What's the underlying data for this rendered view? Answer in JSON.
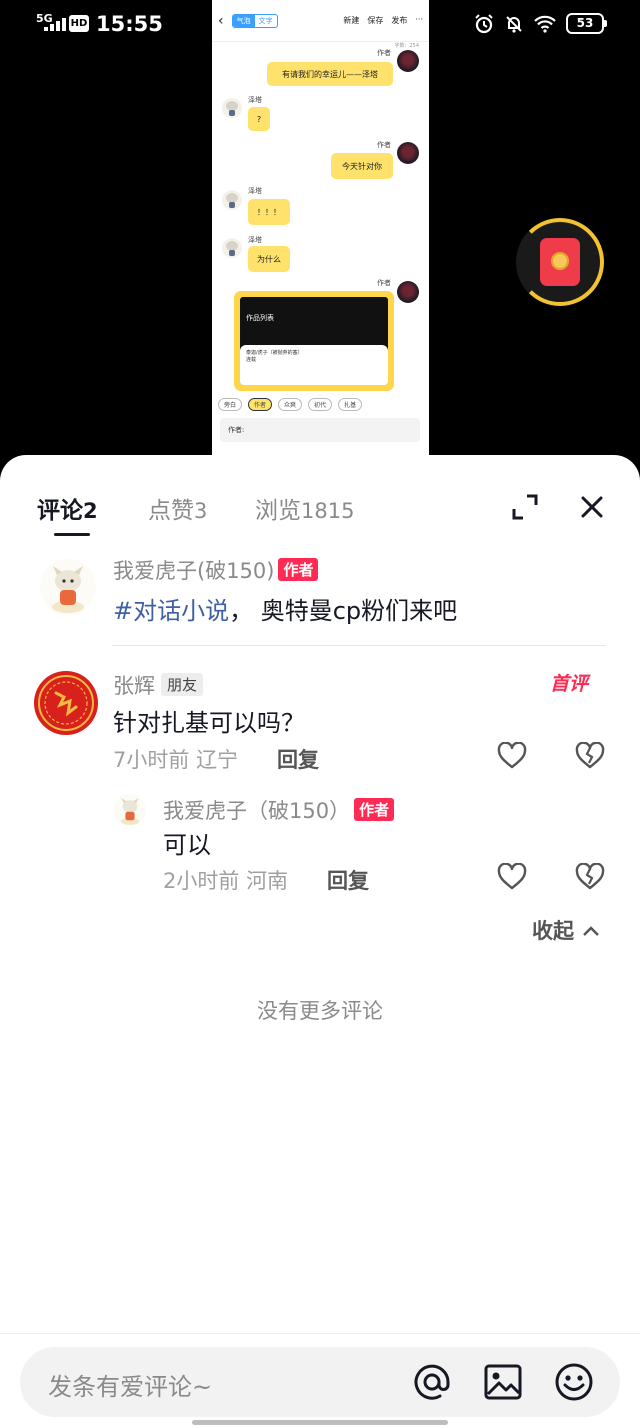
{
  "status_bar": {
    "network": "5G",
    "hd": "HD",
    "time": "15:55",
    "battery": "53"
  },
  "preview": {
    "segments": [
      "气泡",
      "文字"
    ],
    "actions": [
      "新建",
      "保存",
      "发布"
    ],
    "more": "···",
    "word_count": "字数：254",
    "messages": [
      {
        "name": "作者",
        "text": "有请我们的幸运儿——泽塔"
      },
      {
        "name": "泽塔",
        "text": "?"
      },
      {
        "name": "作者",
        "text": "今天针对你"
      },
      {
        "name": "泽塔",
        "text": "！！！"
      },
      {
        "name": "泽塔",
        "text": "为什么"
      },
      {
        "name": "作者",
        "text": ""
      }
    ],
    "card_title": "作品列表",
    "card_sheet_text": "泰迦/虎子（被抛弃的塞）",
    "card_sheet_sub": "连载",
    "chips": [
      "旁白",
      "作者",
      "众爽",
      "初代",
      "扎基"
    ],
    "input_label": "作者:"
  },
  "tabs": [
    {
      "label": "评论",
      "count": "2"
    },
    {
      "label": "点赞",
      "count": "3"
    },
    {
      "label": "浏览",
      "count": "1815"
    }
  ],
  "author_post": {
    "username": "我爱虎子(破150)",
    "tag": "作者",
    "hashtag": "#对话小说",
    "text": "， 奥特曼cp粉们来吧"
  },
  "comment": {
    "username": "张辉",
    "friend_tag": "朋友",
    "badge": "首评",
    "text": "针对扎基可以吗？",
    "time": "7小时前",
    "location": "辽宁",
    "reply_label": "回复",
    "reply": {
      "username": "我爱虎子（破150）",
      "tag": "作者",
      "text": "可以",
      "time": "2小时前",
      "location": "河南",
      "reply_label": "回复"
    }
  },
  "collapse_label": "收起",
  "no_more": "没有更多评论",
  "input": {
    "placeholder": "发条有爱评论~"
  },
  "colors": {
    "accent": "#fe2c55",
    "hashtag": "#3f5fa6",
    "bubble": "#ffe26b"
  },
  "icons": [
    "expand-icon",
    "close-icon",
    "heart-icon",
    "heart-break-icon",
    "chevron-up-icon",
    "at-icon",
    "image-icon",
    "emoji-icon"
  ]
}
